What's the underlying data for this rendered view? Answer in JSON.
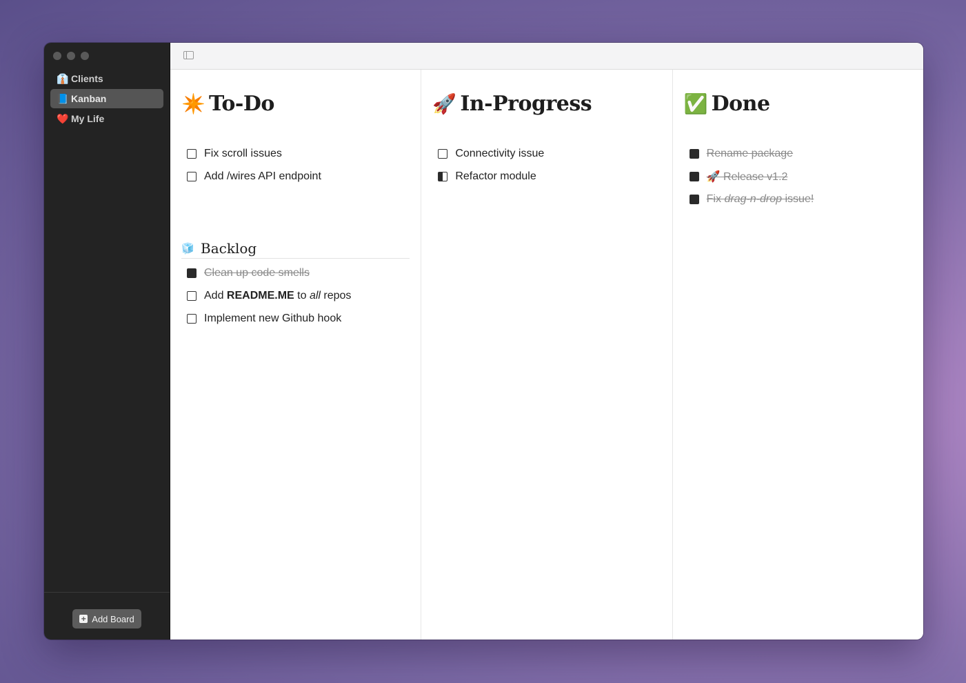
{
  "sidebar": {
    "items": [
      {
        "emoji": "👔",
        "label": "Clients",
        "active": false
      },
      {
        "emoji": "📘",
        "label": "Kanban",
        "active": true
      },
      {
        "emoji": "❤️",
        "label": "My Life",
        "active": false
      }
    ],
    "add_board_label": "Add Board"
  },
  "columns": [
    {
      "emoji": "✴️",
      "title": "To-Do",
      "tasks": [
        {
          "text": "Fix scroll issues",
          "state": "open"
        },
        {
          "text": "Add /wires API endpoint",
          "state": "open"
        }
      ],
      "section": {
        "emoji": "🧊",
        "title": "Backlog",
        "tasks": [
          {
            "text": "Clean up code smells",
            "state": "done"
          },
          {
            "text_parts": [
              "Add ",
              "README.ME",
              " to ",
              "all",
              " repos"
            ],
            "state": "open"
          },
          {
            "text": "Implement new Github hook",
            "state": "open"
          }
        ]
      }
    },
    {
      "emoji": "🚀",
      "title": "In-Progress",
      "tasks": [
        {
          "text": "Connectivity issue",
          "state": "open"
        },
        {
          "text": "Refactor module",
          "state": "partial"
        }
      ]
    },
    {
      "emoji": "✅",
      "title": "Done",
      "tasks": [
        {
          "text": "Rename package",
          "state": "done"
        },
        {
          "text": "🚀 Release v1.2",
          "state": "done"
        },
        {
          "text_parts": [
            "Fix ",
            "drag-n-drop",
            " issue!"
          ],
          "state": "done"
        }
      ]
    }
  ]
}
